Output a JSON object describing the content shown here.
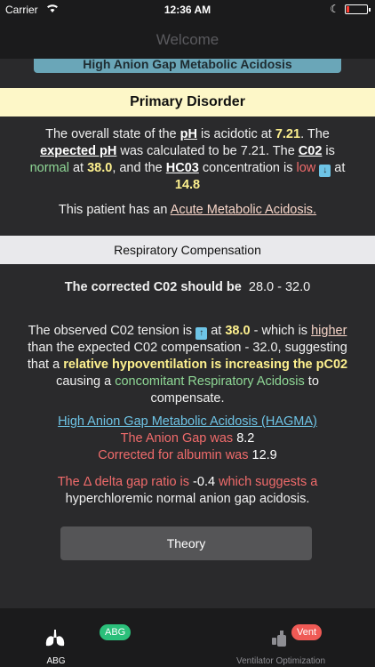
{
  "status": {
    "carrier": "Carrier",
    "time": "12:36 AM"
  },
  "nav": {
    "title": "Welcome"
  },
  "top_button": "High Anion Gap Metabolic Acidosis",
  "primary": {
    "header": "Primary Disorder",
    "s1": "The overall state of the ",
    "ph": "pH",
    "s2": " is acidotic at ",
    "ph_val": "7.21",
    "s3": ". The ",
    "expected_ph": "expected pH",
    "s4": " was calculated to be 7.21. The ",
    "co2": "C02",
    "s5": " is ",
    "normal": "normal",
    "s6": " at ",
    "co2_val": "38.0",
    "s7": ", and the ",
    "hco3": "HC03",
    "s8": " concentration is ",
    "low": "low",
    "s9": " at ",
    "hco3_val": "14.8",
    "diag_prefix": "This patient has an ",
    "diag": "Acute Metabolic Acidosis."
  },
  "resp": {
    "header": "Respiratory Compensation",
    "corrected_label": "The corrected C02 should be",
    "corrected_range": "28.0 - 32.0",
    "o1": "The observed C02 tension is ",
    "o2": " at ",
    "o_val": "38.0",
    "o3": " - which is ",
    "higher": "higher",
    "o4": " than the expected C02 compensation - 32.0, suggesting that a ",
    "relative": "relative hypoventilation is increasing the pC02",
    "o5": " causing a ",
    "concomitant": "concomitant Respiratory Acidosis",
    "o6": " to compensate."
  },
  "hagma": {
    "link": "High Anion Gap Metabolic Acidosis (HAGMA)",
    "ag_label": "The Anion Gap was ",
    "ag_val": "8.2",
    "alb_label": "Corrected for albumin was ",
    "alb_val": "12.9"
  },
  "delta": {
    "d1": "The Δ delta gap ratio is ",
    "d_val": "-0.4",
    "d2": " which suggests a",
    "d3": "hyperchloremic normal anion gap acidosis."
  },
  "theory_button": "Theory",
  "tabs": [
    {
      "label": "ABG",
      "badge": "ABG"
    },
    {
      "label": "Ventilator Optimization",
      "badge": "Vent"
    }
  ],
  "colors": {
    "accent_blue": "#6aa6b8",
    "yellow_header": "#fdf7c8",
    "badge_green": "#2bbf7a",
    "badge_red": "#ef5a55"
  }
}
